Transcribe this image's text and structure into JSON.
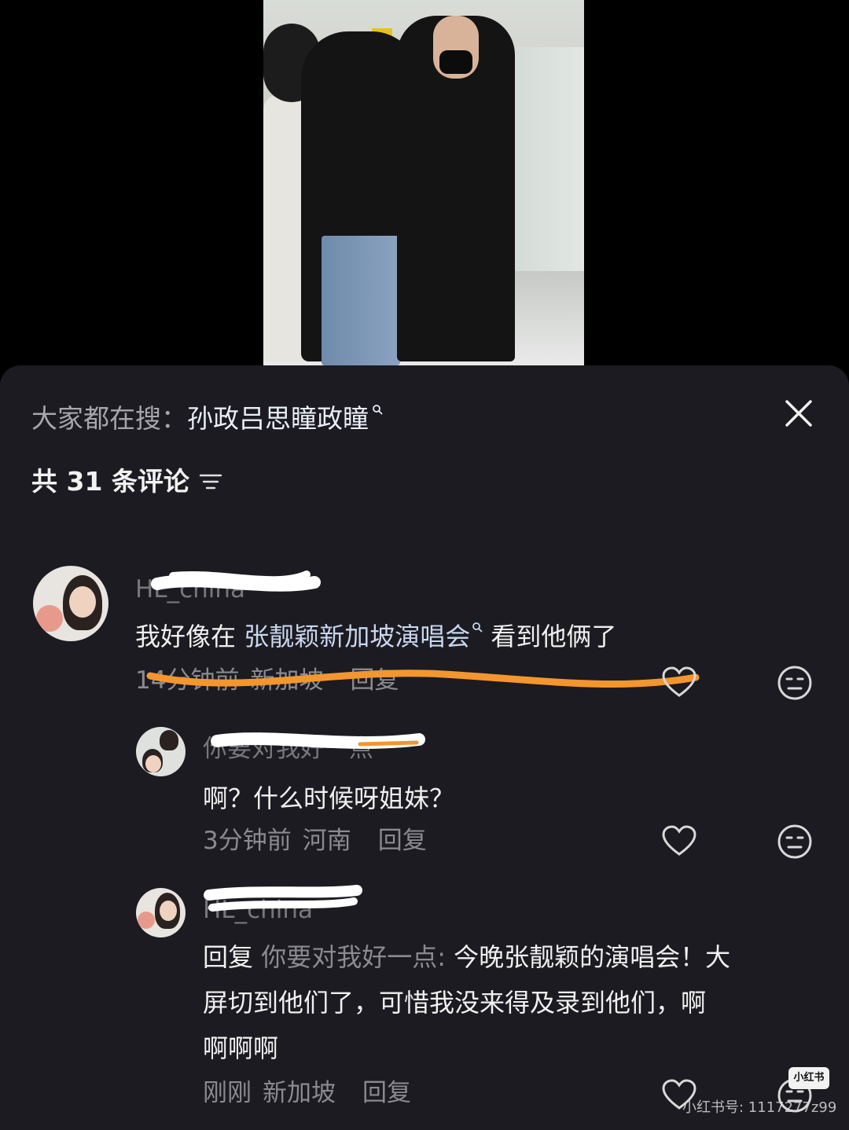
{
  "video": {
    "scene": "airport"
  },
  "sheet": {
    "search_prefix": "大家都在搜：",
    "search_term": "孙政吕思瞳政瞳",
    "comment_count_label": "共 31 条评论",
    "close_icon": "close-icon",
    "sort_icon": "sort-icon"
  },
  "comments": [
    {
      "username": "HL_china",
      "text_before": "我好像在 ",
      "link": "张靓颖新加坡演唱会",
      "text_after": " 看到他俩了",
      "time": "14分钟前",
      "location": "新加坡",
      "reply_label": "回复"
    },
    {
      "username": "你要对我好一点",
      "text": "啊？什么时候呀姐妹？",
      "time": "3分钟前",
      "location": "河南",
      "reply_label": "回复"
    },
    {
      "username": "HL_china",
      "reply_prefix": "回复 ",
      "reply_target": "你要对我好一点: ",
      "text_line1": "今晚张靓颖的演唱会！大",
      "text_line2": "屏切到他们了，可惜我没来得及录到他们，啊",
      "text_line3": "啊啊啊",
      "time": "刚刚",
      "location": "新加坡",
      "reply_label": "回复"
    }
  ],
  "watermark": {
    "logo": "小红书",
    "text": "小红书号: 1117277z99"
  },
  "colors": {
    "sheet_bg": "#1b1b21",
    "scribble": "#f3962e",
    "link": "#c9d6ee",
    "muted": "#8a8a90"
  }
}
